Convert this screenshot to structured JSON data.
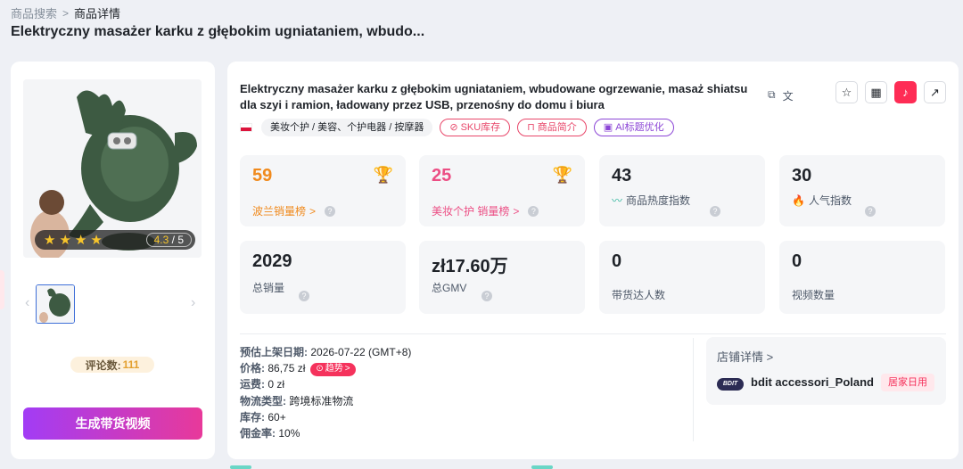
{
  "breadcrumb": {
    "root": "商品搜索",
    "current": "商品详情"
  },
  "page_title": "Elektryczny masażer karku z głębokim ugniataniem, wbudo...",
  "gallery": {
    "rating_value": "4.3",
    "rating_max": "5",
    "stars_filled": 4,
    "review_label": "评论数:",
    "review_count": "111"
  },
  "generate_button": "生成带货视频",
  "product": {
    "title": "Elektryczny masażer karku z głębokim ugniataniem, wbudowane ogrzewanie, masaż shiatsu dla szyi i ramion, ładowany przez USB, przenośny do domu i biura",
    "category": "美妆个护 / 美容、个护电器 / 按摩器",
    "tag_sku": "SKU库存",
    "tag_intro": "商品简介",
    "tag_ai": "AI标题优化"
  },
  "metrics": [
    {
      "value": "59",
      "label": "波兰销量榜",
      "color": "#f08a1d"
    },
    {
      "value": "25",
      "label": "美妆个护 销量榜",
      "color": "#ec4e84"
    },
    {
      "value": "43",
      "label": "商品热度指数"
    },
    {
      "value": "30",
      "label": "人气指数"
    },
    {
      "value": "2029",
      "label": "总销量"
    },
    {
      "value": "zł17.60万",
      "label": "总GMV"
    },
    {
      "value": "0",
      "label": "带货达人数"
    },
    {
      "value": "0",
      "label": "视频数量"
    }
  ],
  "info": {
    "launch_k": "预估上架日期:",
    "launch_v": "2026-07-22 (GMT+8)",
    "price_k": "价格:",
    "price_v": "86,75 zł",
    "trend": "趋势",
    "ship_k": "运费:",
    "ship_v": "0 zł",
    "logistics_k": "物流类型:",
    "logistics_v": "跨境标准物流",
    "stock_k": "库存:",
    "stock_v": "60+",
    "commission_k": "佣金率:",
    "commission_v": "10%"
  },
  "shop": {
    "header": "店铺详情",
    "logo_text": "BDIT",
    "name": "bdit accessori_Poland",
    "badge": "居家日用"
  }
}
